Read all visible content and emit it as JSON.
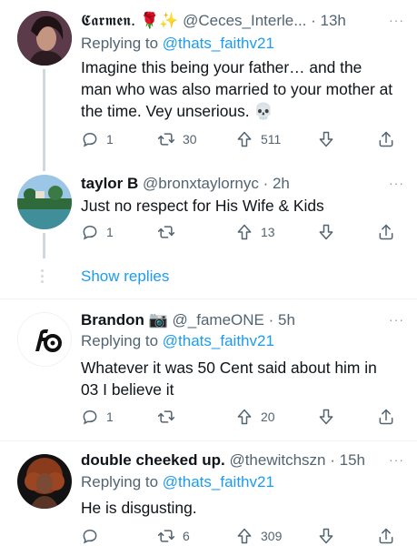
{
  "tweets": [
    {
      "name": "𝕮𝖆𝖗𝖒𝖊𝖓.",
      "name_emoji": "🌹✨",
      "handle": "@Ceces_Interle...",
      "time": "· 13h",
      "replying_label": "Replying to",
      "replying_handle": "@thats_faithv21",
      "text": "Imagine this being your father… and the man who was also married to your mother at the time. Vey unserious. 💀",
      "replies": "1",
      "retweets": "30",
      "likes": "511",
      "more": "···"
    },
    {
      "name": "taylor B",
      "handle": "@bronxtaylornyc",
      "time": "· 2h",
      "text": "Just no respect for His Wife & Kids",
      "replies": "1",
      "retweets": "",
      "likes": "13",
      "more": "···"
    },
    {
      "name": "Brandon",
      "name_emoji": "📷",
      "handle": "@_fameONE",
      "time": "· 5h",
      "replying_label": "Replying to",
      "replying_handle": "@thats_faithv21",
      "text": "Whatever it was 50 Cent said about him in 03 I believe it",
      "replies": "1",
      "retweets": "",
      "likes": "20",
      "more": "···"
    },
    {
      "name": "double cheeked up.",
      "handle": "@thewitchszn",
      "time": "· 15h",
      "replying_label": "Replying to",
      "replying_handle": "@thats_faithv21",
      "text": "He is disgusting.",
      "replies": "",
      "retweets": "6",
      "likes": "309",
      "more": "···"
    }
  ],
  "show_replies_label": "Show replies",
  "colors": {
    "accent": "#1d9bf0",
    "secondary_text": "#536471",
    "primary_text": "#0f1419",
    "divider": "#eff3f4"
  }
}
